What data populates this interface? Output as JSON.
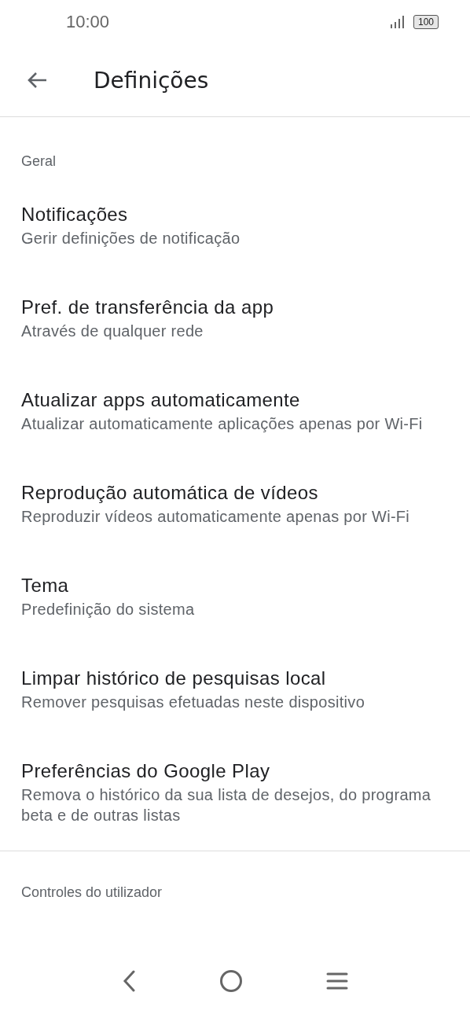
{
  "status_bar": {
    "time": "10:00",
    "battery": "100"
  },
  "header": {
    "title": "Definições"
  },
  "sections": [
    {
      "title": "Geral",
      "items": [
        {
          "title": "Notificações",
          "subtitle": "Gerir definições de notificação"
        },
        {
          "title": "Pref. de transferência da app",
          "subtitle": "Através de qualquer rede"
        },
        {
          "title": "Atualizar apps automaticamente",
          "subtitle": "Atualizar automaticamente aplicações apenas por Wi-Fi"
        },
        {
          "title": "Reprodução automática de vídeos",
          "subtitle": "Reproduzir vídeos automaticamente apenas por Wi-Fi"
        },
        {
          "title": "Tema",
          "subtitle": "Predefinição do sistema"
        },
        {
          "title": "Limpar histórico de pesquisas local",
          "subtitle": "Remover pesquisas efetuadas neste dispositivo"
        },
        {
          "title": "Preferências do Google Play",
          "subtitle": "Remova o histórico da sua lista de desejos, do programa beta e de outras listas"
        }
      ]
    },
    {
      "title": "Controles do utilizador"
    }
  ]
}
